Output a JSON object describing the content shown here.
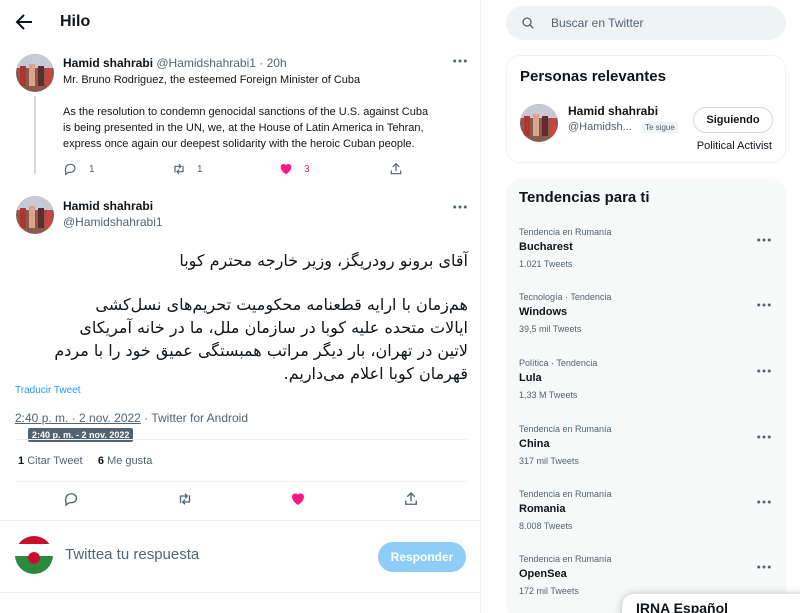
{
  "header": {
    "title": "Hilo"
  },
  "parent_tweet": {
    "name": "Hamid shahrabi",
    "handle": "@Hamidshahrabi1",
    "time": "· 20h",
    "line1": "Mr. Bruno Rodriguez, the esteemed Foreign Minister of Cuba",
    "line2": "As the resolution to condemn genocidal sanctions of the U.S. against Cuba",
    "line3": "is being presented in the UN, we, at the House of Latin America in Tehran,",
    "line4": "express once again our deepest solidarity with the heroic Cuban people.",
    "replies": "1",
    "retweets": "1",
    "likes": "3"
  },
  "main_tweet": {
    "name": "Hamid shahrabi",
    "handle": "@Hamidshahrabi1",
    "fa_line1": "آقای برونو رودریگز، وزیر خارجه محترم کوبا",
    "fa_line2": "هم‌زمان با ارایه قطعنامه محکومیت تحریم‌های نسل‌کشی",
    "fa_line3": "ایالات متحده علیه کوبا در سازمان ملل، ما در خانه آمریکای",
    "fa_line4": "لاتین در تهران، بار دیگر مراتب همبستگی عمیق خود را با مردم",
    "fa_line5": "قهرمان کوبا اعلام می‌داریم.",
    "translate": "Traducir Tweet",
    "datetime": "2:40 p. m. · 2 nov. 2022",
    "source": "· Twitter for Android",
    "tooltip": "2:40 p. m. - 2 nov. 2022",
    "quote_count": "1",
    "quote_label": "Citar Tweet",
    "like_count": "6",
    "like_label": "Me gusta"
  },
  "reply": {
    "placeholder": "Twittea tu respuesta",
    "button": "Responder"
  },
  "search": {
    "placeholder": "Buscar en Twitter"
  },
  "relevant": {
    "title": "Personas relevantes",
    "name": "Hamid shahrabi",
    "handle": "@Hamidsh...",
    "badge": "Te sigue",
    "button": "Siguiendo",
    "bio": "Political Activist"
  },
  "trends": {
    "title": "Tendencias para ti",
    "items": [
      {
        "context": "Tendencia en Rumanía",
        "name": "Bucharest",
        "count": "1.021 Tweets"
      },
      {
        "context": "Tecnología · Tendencia",
        "name": "Windows",
        "count": "39,5 mil Tweets"
      },
      {
        "context": "Política · Tendencia",
        "name": "Lula",
        "count": "1,33 M Tweets"
      },
      {
        "context": "Tendencia en Rumanía",
        "name": "China",
        "count": "317 mil Tweets"
      },
      {
        "context": "Tendencia en Rumanía",
        "name": "Romania",
        "count": "8.008 Tweets"
      },
      {
        "context": "Tendencia en Rumanía",
        "name": "OpenSea",
        "count": "172 mil Tweets"
      }
    ]
  },
  "toast": {
    "label": "IRNA Español"
  },
  "colors": {
    "accent": "#1d9bf0",
    "like": "#f91880",
    "muted": "#536471",
    "button_disabled": "#8ecdf7"
  },
  "icons": [
    "back-arrow-icon",
    "more-icon",
    "reply-icon",
    "retweet-icon",
    "heart-icon",
    "share-icon",
    "search-icon"
  ]
}
